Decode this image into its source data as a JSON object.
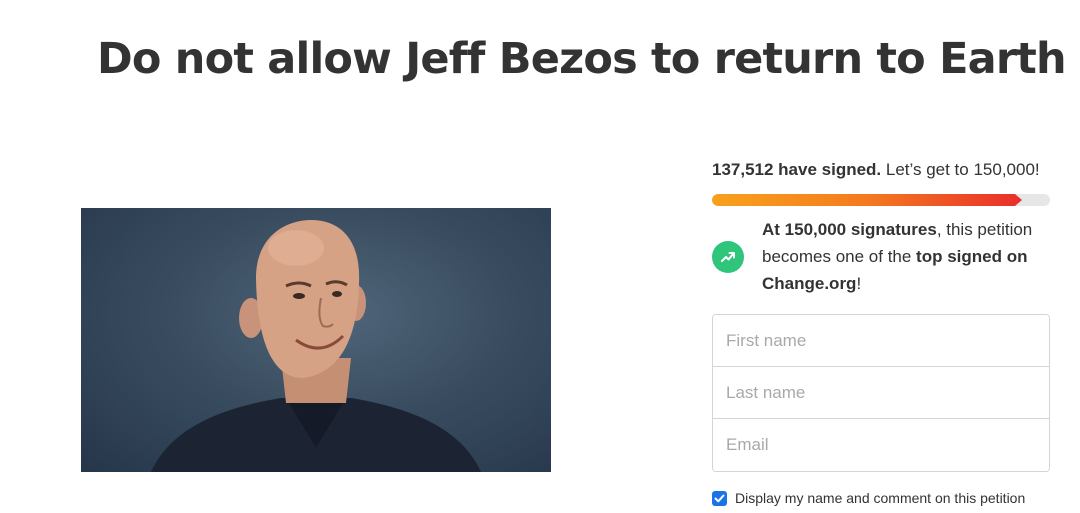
{
  "petition": {
    "title": "Do not allow Jeff Bezos to return to Earth"
  },
  "signatures": {
    "signed_count_text": "137,512 have signed.",
    "goal_text": " Let’s get to 150,000!",
    "progress_fraction": 0.917
  },
  "milestone": {
    "icon": "trending-up-icon",
    "strong1": "At 150,000 signatures",
    "text1": ", this petition becomes one of the ",
    "strong2": "top signed on Change.org",
    "text2": "!"
  },
  "form": {
    "first_name_placeholder": "First name",
    "last_name_placeholder": "Last name",
    "email_placeholder": "Email",
    "consent_label": "Display my name and comment on this petition",
    "consent_checked": true
  },
  "colors": {
    "progress_start": "#f9a11b",
    "progress_end": "#e8312a",
    "milestone_green": "#2fc57a",
    "checkbox_blue": "#1a73e8"
  }
}
